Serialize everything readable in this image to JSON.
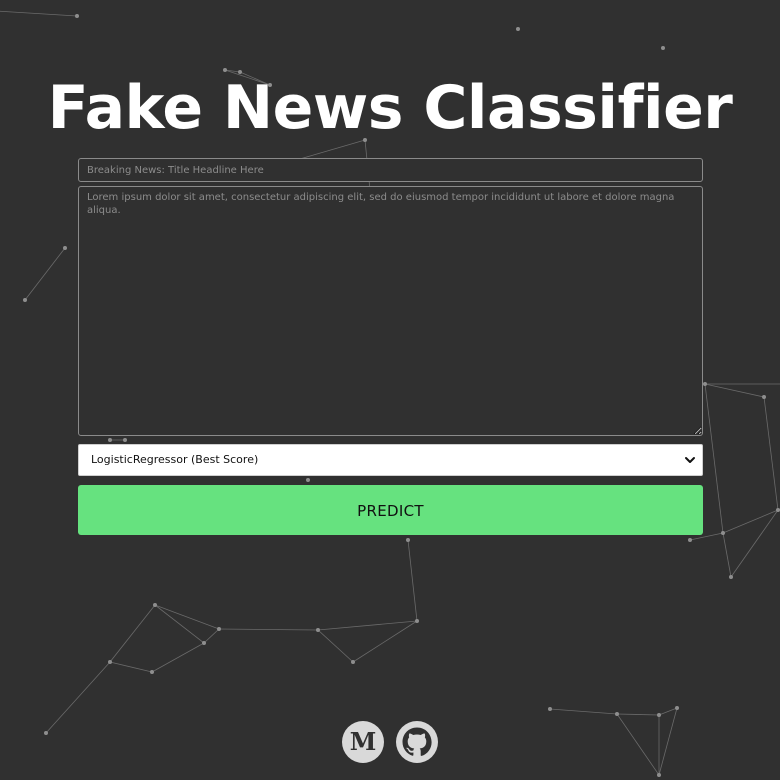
{
  "page": {
    "title": "Fake News Classifier",
    "background_color": "#303030",
    "accent_color": "#66e27f"
  },
  "form": {
    "title_placeholder": "Breaking News: Title Headline Here",
    "body_placeholder": "Lorem ipsum dolor sit amet, consectetur adipiscing elit, sed do eiusmod tempor incididunt ut labore et dolore magna aliqua.",
    "model_select": {
      "selected": "LogisticRegressor (Best Score)",
      "icon": "chevron-down-icon"
    },
    "predict_label": "PREDICT"
  },
  "footer": {
    "links": [
      {
        "name": "medium",
        "icon": "medium-icon",
        "glyph": "M"
      },
      {
        "name": "github",
        "icon": "github-icon"
      }
    ]
  }
}
